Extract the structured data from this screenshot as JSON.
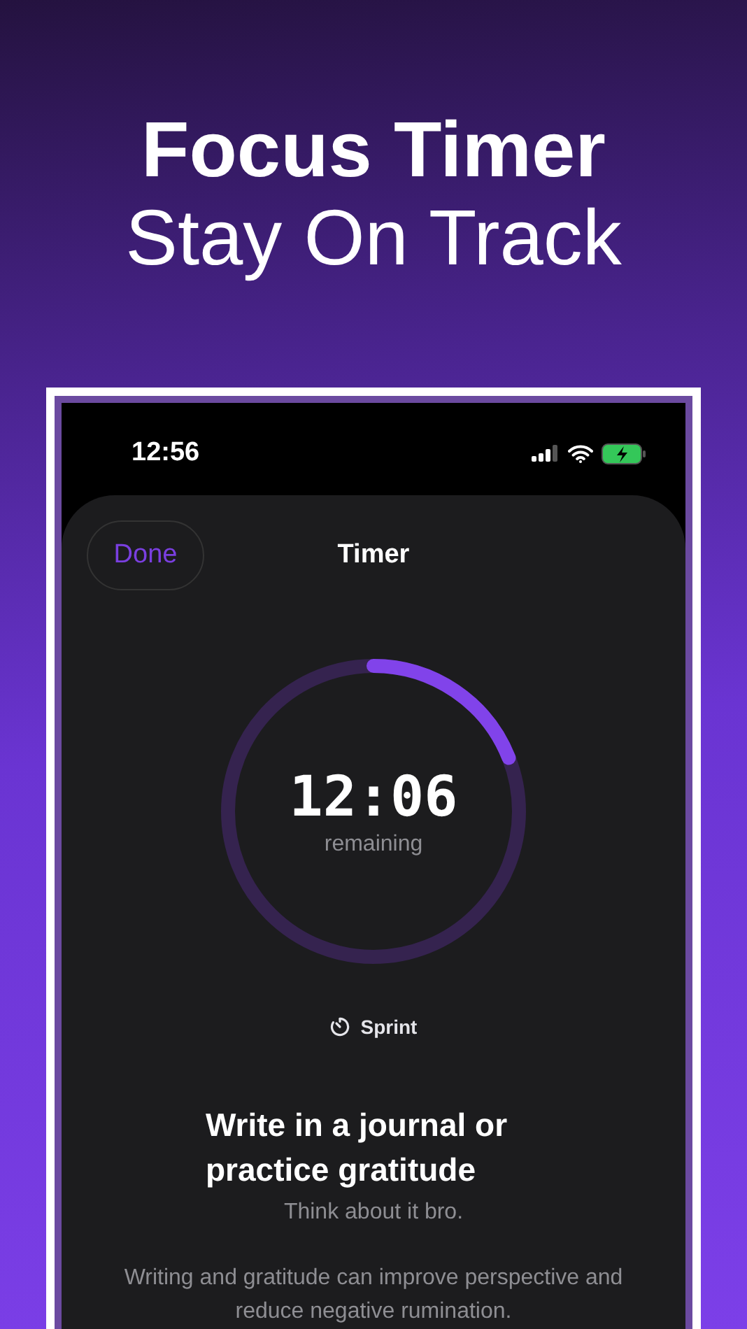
{
  "headline": {
    "title": "Focus Timer",
    "subtitle": "Stay On Track"
  },
  "status_bar": {
    "time": "12:56"
  },
  "nav": {
    "done": "Done",
    "title": "Timer"
  },
  "timer": {
    "time": "12:06",
    "caption": "remaining",
    "level": 0.19
  },
  "mode": {
    "label": "Sprint"
  },
  "task": {
    "title": "Write in a journal or practice gratitude",
    "subtitle": "Think about it bro.",
    "description": "Writing and gratitude can improve perspective and reduce negative rumination."
  }
}
